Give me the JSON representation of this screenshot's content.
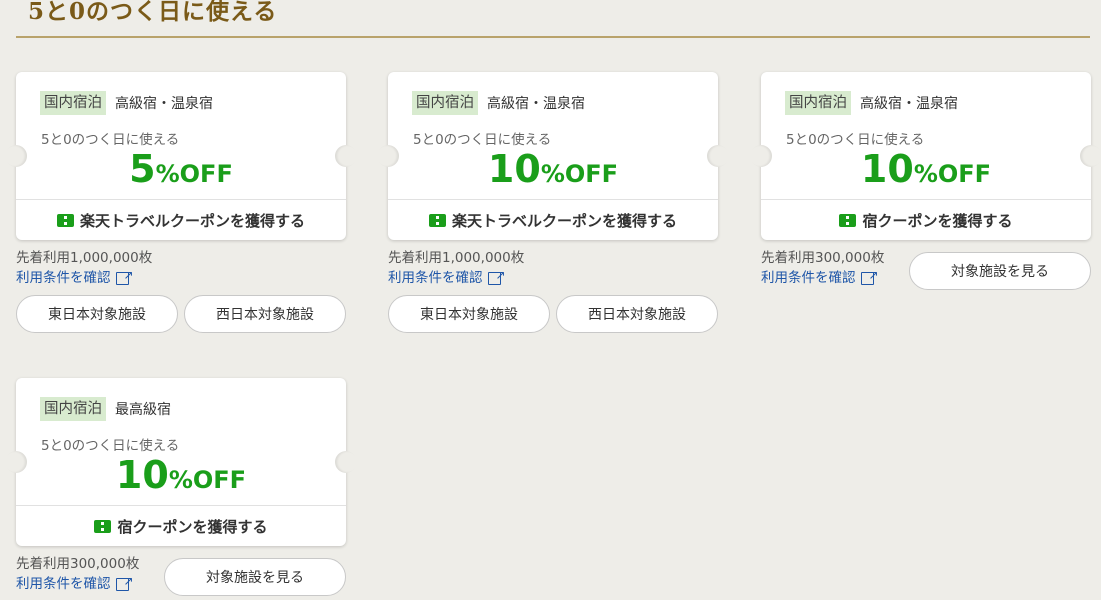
{
  "section": {
    "title": "5と0のつく日に使える"
  },
  "coupons": [
    {
      "tag": "国内宿泊",
      "category": "高級宿・温泉宿",
      "subtitle": "5と0のつく日に使える",
      "discount_number": "5",
      "discount_unit": "%OFF",
      "action": "楽天トラベルクーポンを獲得する",
      "limit": "先着利用1,000,000枚",
      "terms": "利用条件を確認",
      "buttons": [
        "東日本対象施設",
        "西日本対象施設"
      ]
    },
    {
      "tag": "国内宿泊",
      "category": "高級宿・温泉宿",
      "subtitle": "5と0のつく日に使える",
      "discount_number": "10",
      "discount_unit": "%OFF",
      "action": "楽天トラベルクーポンを獲得する",
      "limit": "先着利用1,000,000枚",
      "terms": "利用条件を確認",
      "buttons": [
        "東日本対象施設",
        "西日本対象施設"
      ]
    },
    {
      "tag": "国内宿泊",
      "category": "高級宿・温泉宿",
      "subtitle": "5と0のつく日に使える",
      "discount_number": "10",
      "discount_unit": "%OFF",
      "action": "宿クーポンを獲得する",
      "limit": "先着利用300,000枚",
      "terms": "利用条件を確認",
      "buttons": [
        "対象施設を見る"
      ]
    },
    {
      "tag": "国内宿泊",
      "category": "最高級宿",
      "subtitle": "5と0のつく日に使える",
      "discount_number": "10",
      "discount_unit": "%OFF",
      "action": "宿クーポンを獲得する",
      "limit": "先着利用300,000枚",
      "terms": "利用条件を確認",
      "buttons": [
        "対象施設を見る"
      ]
    }
  ],
  "colors": {
    "accent_green": "#1a9e1a",
    "link_blue": "#1f56a8",
    "title_gold": "#7a5a18"
  }
}
